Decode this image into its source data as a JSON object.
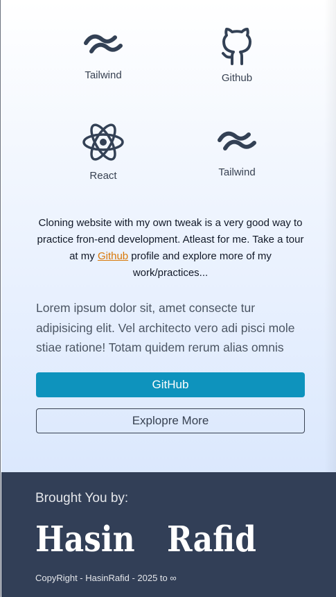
{
  "tools": [
    {
      "label": "Tailwind",
      "icon": "tailwind-icon"
    },
    {
      "label": "Github",
      "icon": "github-icon"
    },
    {
      "label": "React",
      "icon": "react-icon"
    },
    {
      "label": "Tailwind",
      "icon": "tailwind-icon"
    }
  ],
  "intro": {
    "before_link": "Cloning website with my own tweak is a very good way to practice fron-end development. Atleast for me. Take a tour at my ",
    "link_text": "Github",
    "after_link": " profile and explore more of my work/practices..."
  },
  "lorem": "Lorem ipsum dolor sit, amet consecte tur adipisicing elit. Vel architecto vero adi pisci mole stiae ratione! Totam quidem rerum alias omnis",
  "buttons": {
    "primary": "GitHub",
    "secondary": "Explopre More"
  },
  "footer": {
    "brought": "Brought You by:",
    "first_name": "Hasin",
    "last_name": "Rafid",
    "copyright": "CopyRight - HasinRafid - 2025 to ∞"
  },
  "colors": {
    "icon": "#334155",
    "primary_button": "#0e93bd",
    "link": "#d97706",
    "footer_bg": "#323f57"
  }
}
